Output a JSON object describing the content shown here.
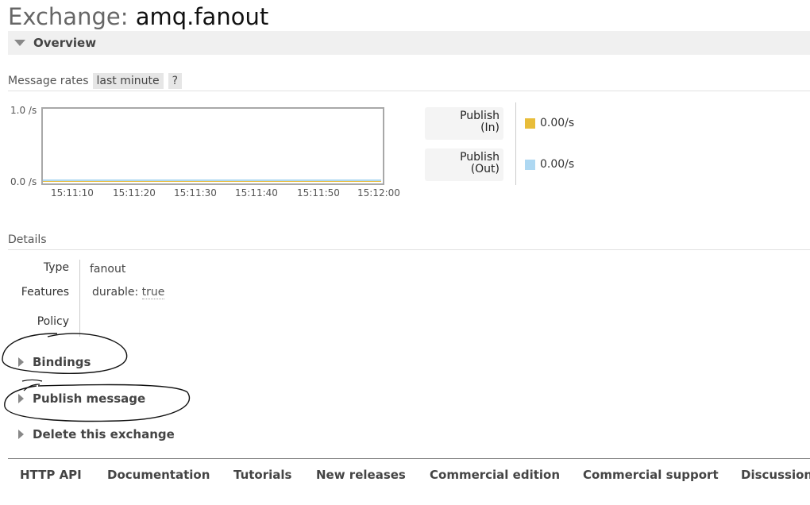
{
  "page": {
    "title_prefix": "Exchange:",
    "title_name": "amq.fanout"
  },
  "overview": {
    "label": "Overview",
    "rates_label": "Message rates",
    "range_chip": "last minute",
    "help_chip": "?"
  },
  "chart_data": {
    "type": "line",
    "ylim": [
      0,
      1.0
    ],
    "y_tick_labels": [
      "1.0 /s",
      "0.0 /s"
    ],
    "x": [
      "15:11:10",
      "15:11:20",
      "15:11:30",
      "15:11:40",
      "15:11:50",
      "15:12:00"
    ],
    "series": [
      {
        "name": "Publish (In)",
        "values": [
          0,
          0,
          0,
          0,
          0,
          0
        ],
        "color": "#e8bd3a"
      },
      {
        "name": "Publish (Out)",
        "values": [
          0,
          0,
          0,
          0,
          0,
          0
        ],
        "color": "#aed8f2"
      }
    ]
  },
  "stats": {
    "publish_in": {
      "line1": "Publish",
      "line2": "(In)",
      "rate": "0.00/s",
      "color": "#e8bd3a"
    },
    "publish_out": {
      "line1": "Publish",
      "line2": "(Out)",
      "rate": "0.00/s",
      "color": "#aed8f2"
    }
  },
  "details": {
    "label": "Details",
    "type_key": "Type",
    "type_value": "fanout",
    "features_key": "Features",
    "features_name": "durable:",
    "features_value": "true",
    "policy_key": "Policy",
    "policy_value": ""
  },
  "sections": {
    "bindings": "Bindings",
    "publish_message": "Publish message",
    "delete_exchange": "Delete this exchange"
  },
  "footer": {
    "links": [
      "HTTP API",
      "Documentation",
      "Tutorials",
      "New releases",
      "Commercial edition",
      "Commercial support",
      "Discussion"
    ]
  }
}
